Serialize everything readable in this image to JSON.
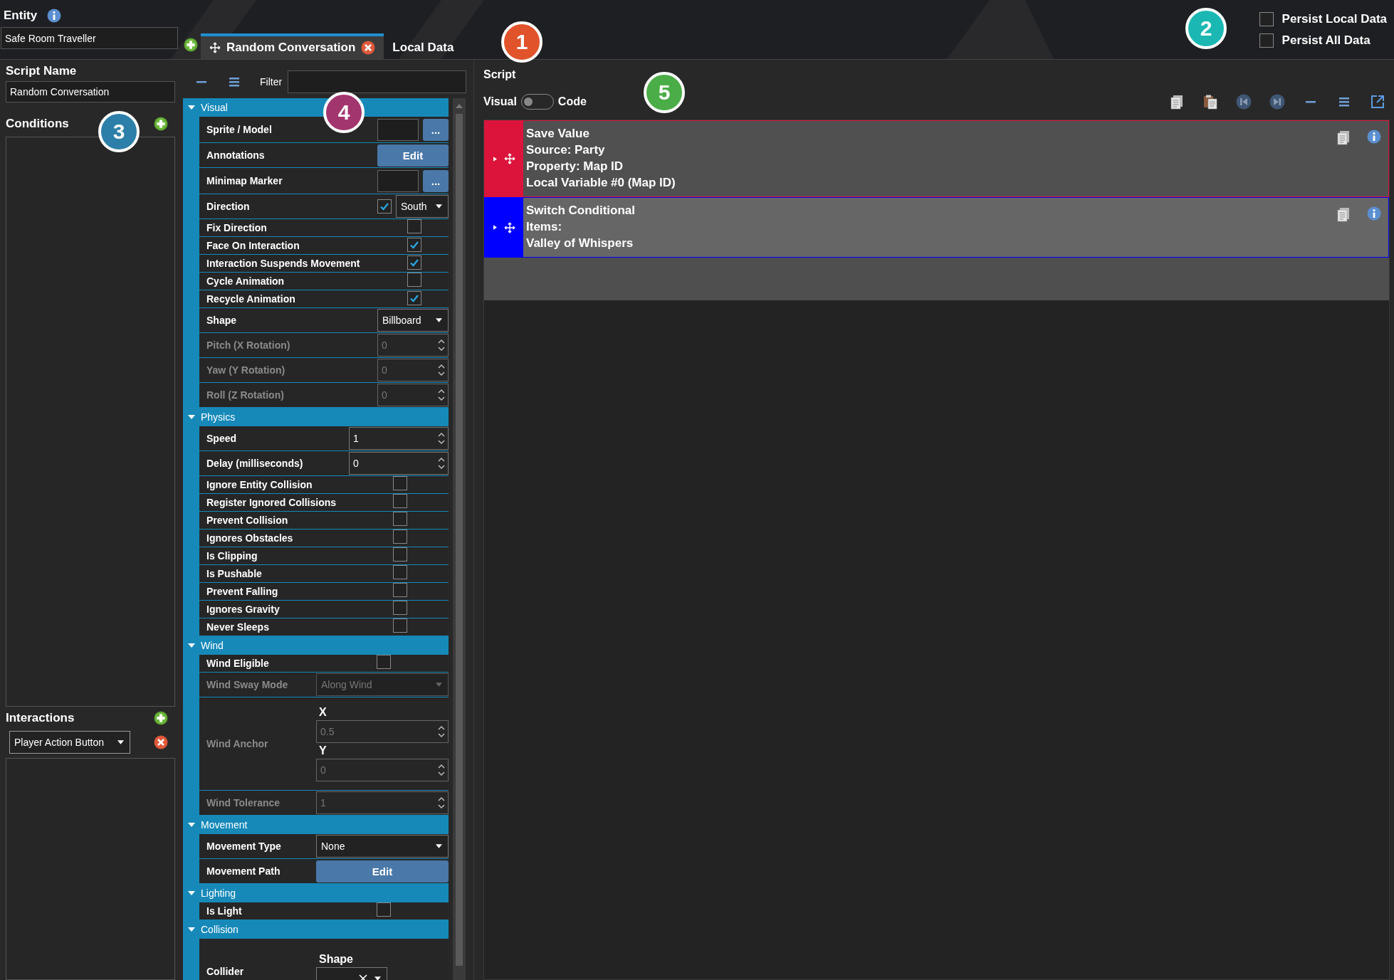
{
  "entity": {
    "label": "Entity",
    "value": "Safe Room Traveller"
  },
  "script_tabs": [
    {
      "label": "Random Conversation",
      "selected": true,
      "closable": true
    },
    {
      "label": "Local Data",
      "selected": false,
      "closable": false
    }
  ],
  "persist_options": [
    {
      "label": "Persist Local Data",
      "checked": false
    },
    {
      "label": "Persist All Data",
      "checked": false
    }
  ],
  "script_name": {
    "label": "Script Name",
    "value": "Random Conversation"
  },
  "conditions": {
    "label": "Conditions"
  },
  "interactions": {
    "label": "Interactions",
    "selected_value": "Player Action Button"
  },
  "filter": {
    "label": "Filter"
  },
  "property_sections": [
    {
      "title": "Visual",
      "expanded": true,
      "rows": [
        {
          "label": "Sprite / Model",
          "kind": "picker",
          "disabled": false,
          "button_label": "..."
        },
        {
          "label": "Annotations",
          "kind": "button",
          "disabled": false,
          "button_label": "Edit"
        },
        {
          "label": "Minimap Marker",
          "kind": "picker",
          "disabled": false,
          "button_label": "..."
        },
        {
          "label": "Direction",
          "kind": "check-select",
          "disabled": false,
          "checked": true,
          "value": "South"
        },
        {
          "label": "Fix Direction",
          "kind": "checkbox",
          "disabled": false,
          "checked": false
        },
        {
          "label": "Face On Interaction",
          "kind": "checkbox",
          "disabled": false,
          "checked": true
        },
        {
          "label": "Interaction Suspends Movement",
          "kind": "checkbox",
          "disabled": false,
          "checked": true
        },
        {
          "label": "Cycle Animation",
          "kind": "checkbox",
          "disabled": false,
          "checked": false
        },
        {
          "label": "Recycle Animation",
          "kind": "checkbox",
          "disabled": false,
          "checked": true
        },
        {
          "label": "Shape",
          "kind": "select",
          "disabled": false,
          "value": "Billboard"
        },
        {
          "label": "Pitch (X Rotation)",
          "kind": "spinner",
          "disabled": true,
          "value": "0"
        },
        {
          "label": "Yaw (Y Rotation)",
          "kind": "spinner",
          "disabled": true,
          "value": "0"
        },
        {
          "label": "Roll (Z Rotation)",
          "kind": "spinner",
          "disabled": true,
          "value": "0"
        }
      ]
    },
    {
      "title": "Physics",
      "expanded": true,
      "rows": [
        {
          "label": "Speed",
          "kind": "spinner",
          "disabled": false,
          "value": "1"
        },
        {
          "label": "Delay (milliseconds)",
          "kind": "spinner",
          "disabled": false,
          "value": "0"
        },
        {
          "label": "Ignore Entity Collision",
          "kind": "checkbox",
          "disabled": false,
          "checked": false
        },
        {
          "label": "Register Ignored Collisions",
          "kind": "checkbox",
          "disabled": false,
          "checked": false
        },
        {
          "label": "Prevent Collision",
          "kind": "checkbox",
          "disabled": false,
          "checked": false
        },
        {
          "label": "Ignores Obstacles",
          "kind": "checkbox",
          "disabled": false,
          "checked": false
        },
        {
          "label": "Is Clipping",
          "kind": "checkbox",
          "disabled": false,
          "checked": false
        },
        {
          "label": "Is Pushable",
          "kind": "checkbox",
          "disabled": false,
          "checked": false
        },
        {
          "label": "Prevent Falling",
          "kind": "checkbox",
          "disabled": false,
          "checked": false
        },
        {
          "label": "Ignores Gravity",
          "kind": "checkbox",
          "disabled": false,
          "checked": false
        },
        {
          "label": "Never Sleeps",
          "kind": "checkbox",
          "disabled": false,
          "checked": false
        }
      ]
    },
    {
      "title": "Wind",
      "expanded": true,
      "rows": [
        {
          "label": "Wind Eligible",
          "kind": "checkbox",
          "disabled": false,
          "checked": false
        },
        {
          "label": "Wind Sway Mode",
          "kind": "select",
          "disabled": true,
          "value": "Along Wind"
        },
        {
          "label": "Wind Anchor",
          "kind": "xy",
          "disabled": true,
          "x_label": "X",
          "x_value": "0.5",
          "y_label": "Y",
          "y_value": "0"
        },
        {
          "label": "Wind Tolerance",
          "kind": "spinner",
          "disabled": true,
          "value": "1"
        }
      ]
    },
    {
      "title": "Movement",
      "expanded": true,
      "rows": [
        {
          "label": "Movement Type",
          "kind": "select",
          "disabled": false,
          "value": "None"
        },
        {
          "label": "Movement Path",
          "kind": "button",
          "disabled": false,
          "button_label": "Edit"
        }
      ]
    },
    {
      "title": "Lighting",
      "expanded": true,
      "rows": [
        {
          "label": "Is Light",
          "kind": "checkbox",
          "disabled": false,
          "checked": false
        }
      ]
    },
    {
      "title": "Collision",
      "expanded": true,
      "rows": [
        {
          "label": "Collider",
          "kind": "collider",
          "disabled": false,
          "field_label": "Shape"
        }
      ]
    }
  ],
  "script": {
    "label": "Script",
    "mode_labels": [
      "Visual",
      "Code"
    ],
    "code_mode": false,
    "items": [
      {
        "color": "#dc143c",
        "lines": [
          "Save Value",
          "Source: Party",
          "Property: Map ID",
          "Local Variable #0 (Map ID)"
        ]
      },
      {
        "color": "#0000ff",
        "lines": [
          "Switch Conditional",
          "Items:",
          "Valley of Whispers"
        ]
      }
    ]
  },
  "callouts": [
    {
      "label": "1",
      "color": "#e0532b"
    },
    {
      "label": "2",
      "color": "#1bb8b3"
    },
    {
      "label": "3",
      "color": "#2c7fa8"
    },
    {
      "label": "4",
      "color": "#a3356e"
    },
    {
      "label": "5",
      "color": "#4aad47"
    }
  ]
}
